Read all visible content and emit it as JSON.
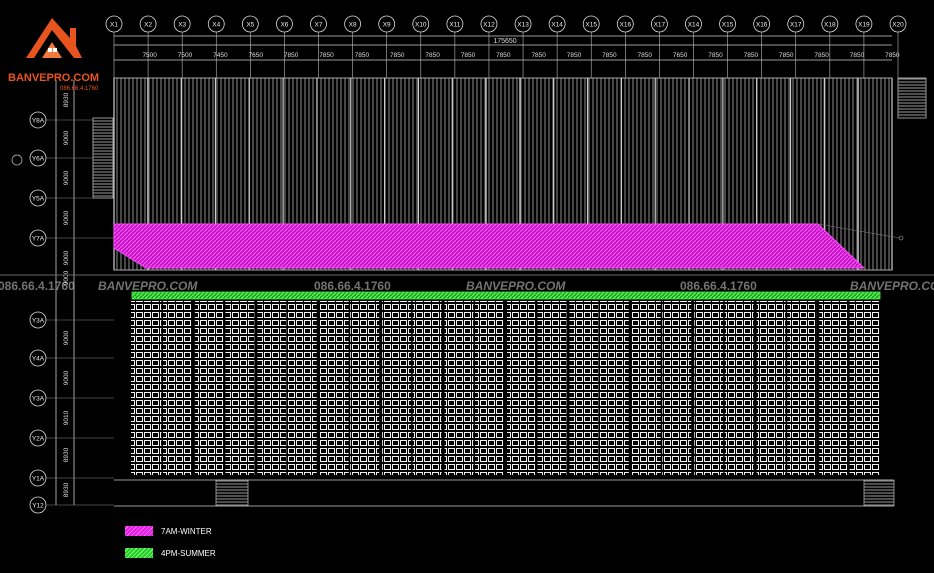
{
  "logo": {
    "brand": "BANVEPRO.COM",
    "phone": "086.66.4.1760"
  },
  "grid_x": [
    "X1",
    "X2",
    "X3",
    "X4",
    "X5",
    "X6",
    "X7",
    "X8",
    "X9",
    "X10",
    "X11",
    "X12",
    "X13",
    "X14",
    "X15",
    "X16",
    "X17",
    "X14",
    "X15",
    "X16",
    "X17",
    "X18",
    "X19",
    "X20"
  ],
  "total_span": "175650",
  "spans": [
    "7500",
    "7500",
    "7450",
    "7650",
    "7850",
    "7850",
    "7850",
    "7850",
    "7850",
    "7850",
    "7850",
    "7850",
    "7850",
    "7850",
    "7850",
    "7650",
    "7850",
    "7850",
    "7850",
    "7850",
    "7850",
    "7850"
  ],
  "grid_y": [
    {
      "label": "Y8A"
    },
    {
      "label": "Y6A"
    },
    {
      "label": "Y5A"
    },
    {
      "label": "Y7A"
    },
    {
      "label": "Y3A"
    },
    {
      "label": "Y4A"
    },
    {
      "label": "Y3A"
    },
    {
      "label": "Y2A"
    },
    {
      "label": "Y1A"
    },
    {
      "label": "Y12"
    }
  ],
  "y_dims": [
    "8930",
    "9000",
    "9000",
    "9000",
    "9000",
    "9000",
    "9000",
    "9000",
    "9010",
    "8930",
    "8930"
  ],
  "watermark": {
    "phone": "086.66.4.1760",
    "brand": "BANVEPRO.COM",
    "brand2": "BANVEPRO.COM"
  },
  "legend": [
    {
      "label": "7AM-WINTER",
      "color": "#e020e0"
    },
    {
      "label": "4PM-SUMMER",
      "color": "#22cc22"
    }
  ],
  "colors": {
    "roof_lines": "#9a9a9a",
    "panels": "#ffffff",
    "grid_axis": "#d0d0d0"
  }
}
